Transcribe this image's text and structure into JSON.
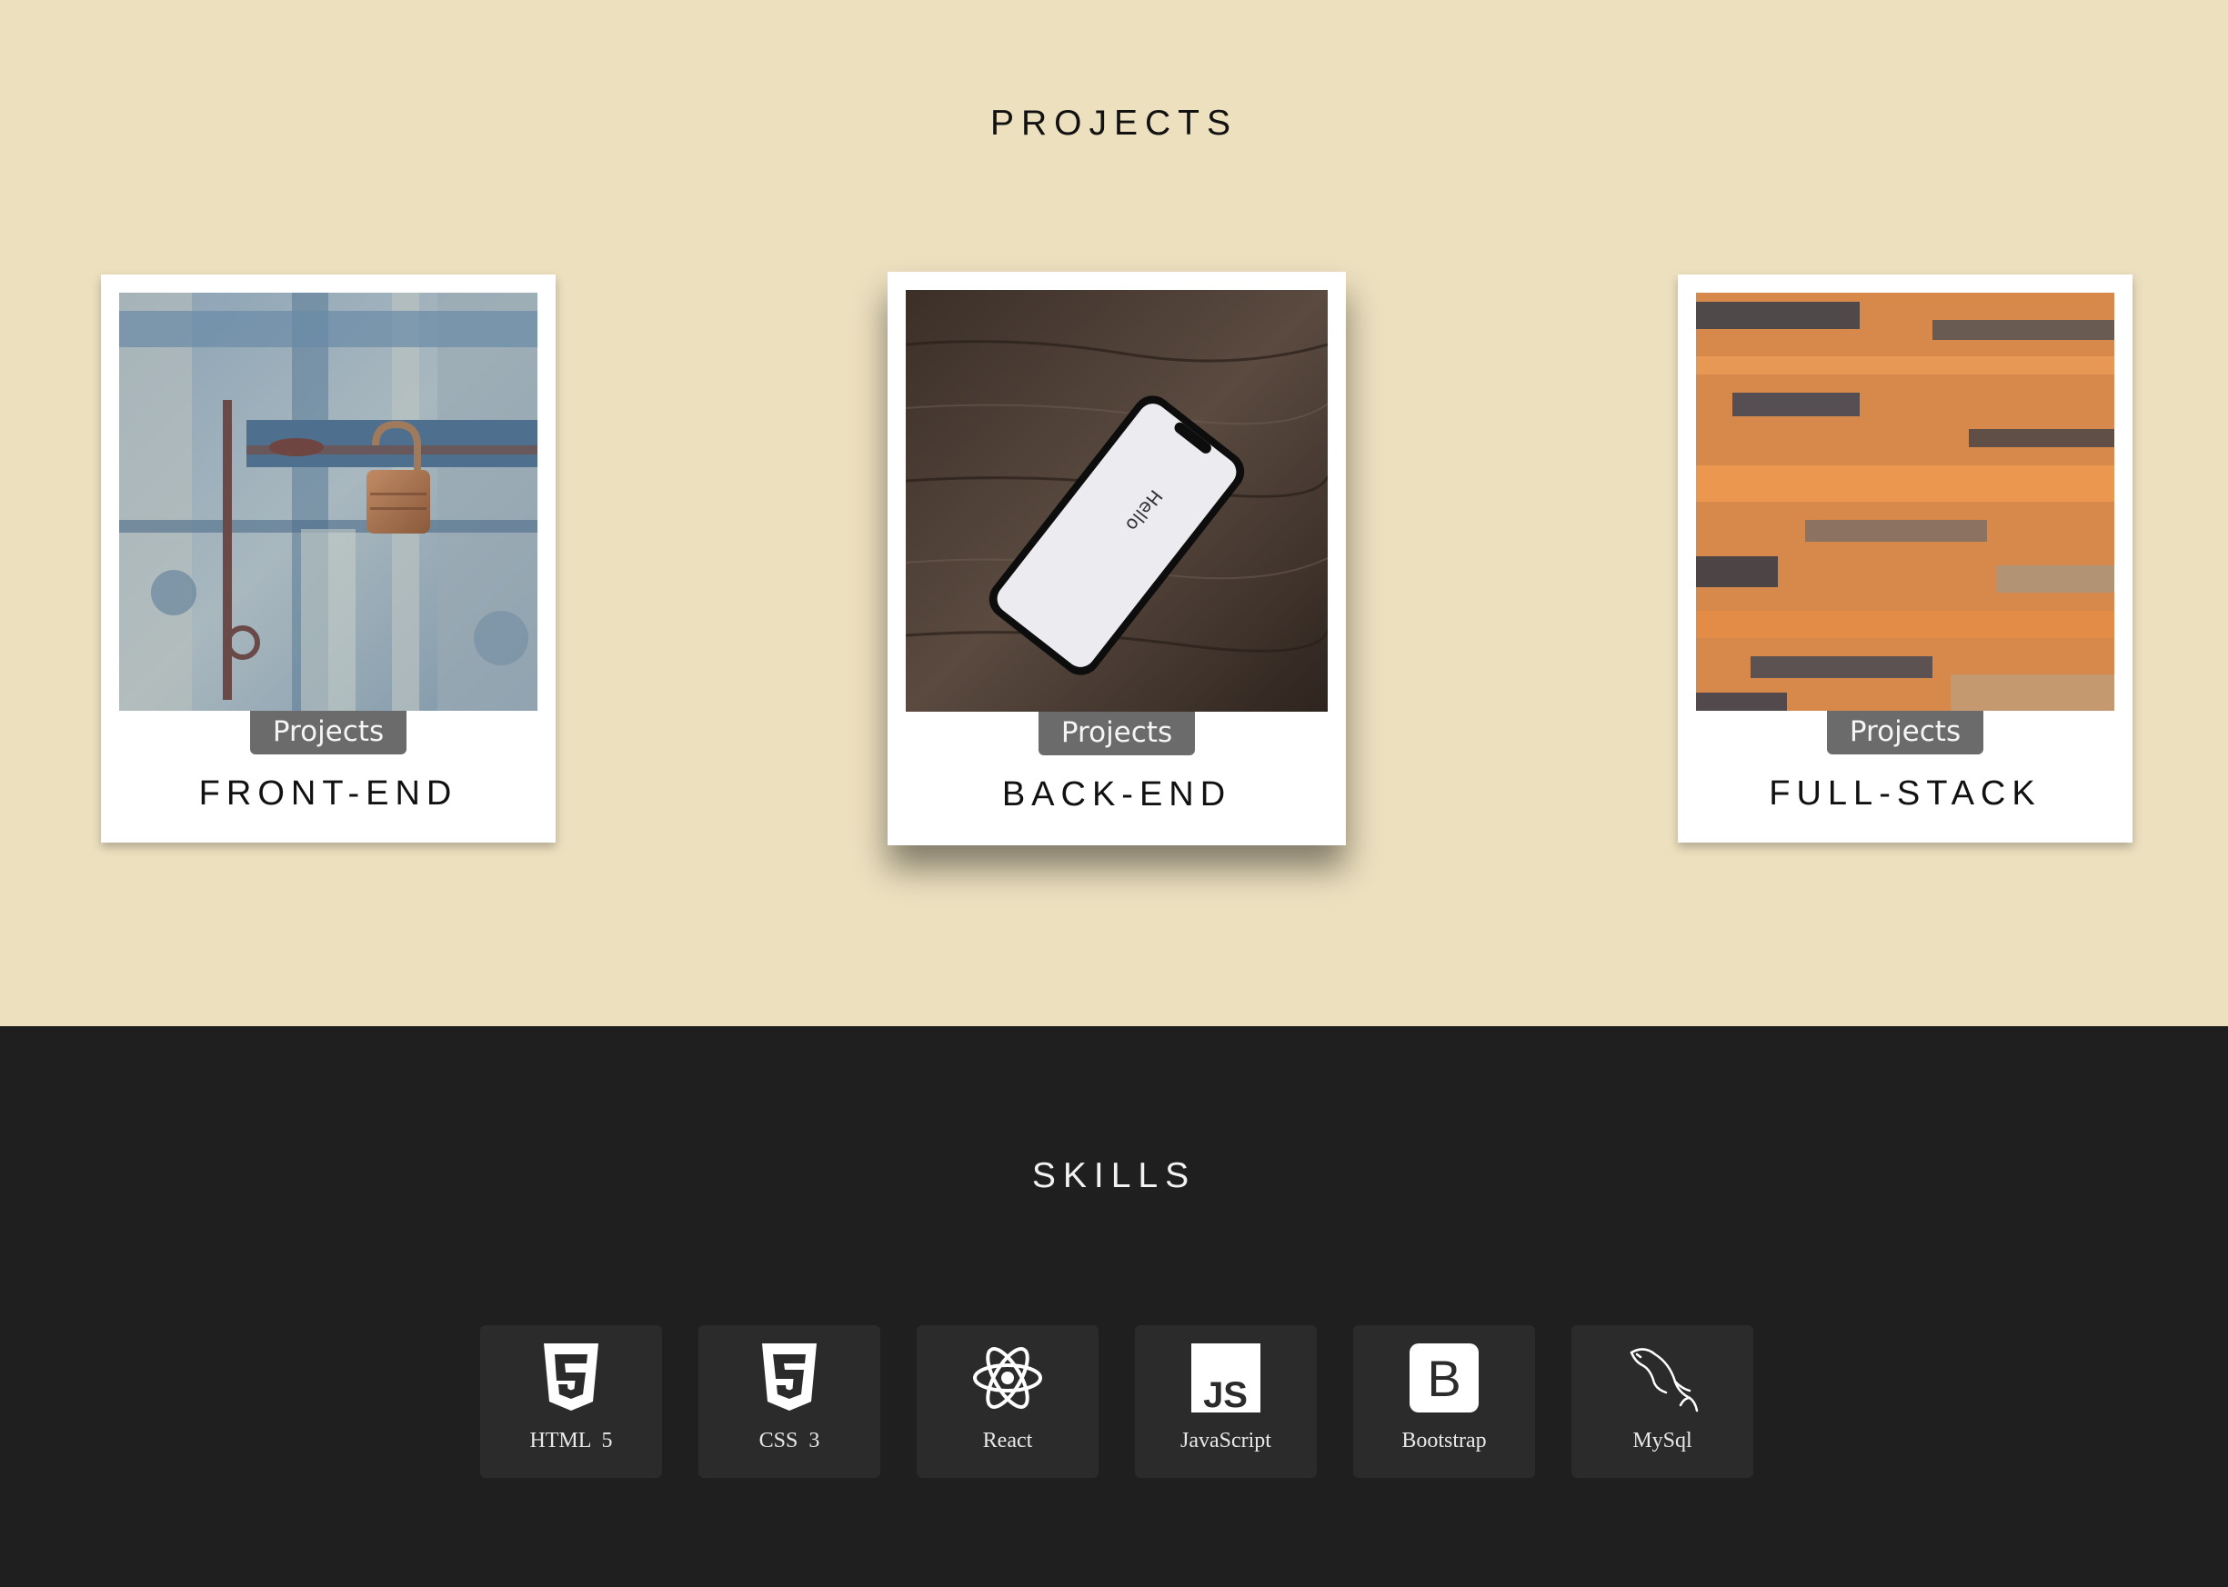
{
  "projects": {
    "title": "PROJECTS",
    "cards": [
      {
        "tag": "Projects",
        "title": "FRONT-END",
        "image": "padlock-on-blue-door"
      },
      {
        "tag": "Projects",
        "title": "BACK-END",
        "image": "phone-on-wood-table",
        "phone_text": "Hello"
      },
      {
        "tag": "Projects",
        "title": "FULL-STACK",
        "image": "orange-motion-blur"
      }
    ]
  },
  "skills": {
    "title": "SKILLS",
    "items": [
      {
        "label": "HTML  5",
        "icon": "html5-icon"
      },
      {
        "label": "CSS  3",
        "icon": "css3-icon"
      },
      {
        "label": "React",
        "icon": "react-icon"
      },
      {
        "label": "JavaScript",
        "icon": "javascript-icon"
      },
      {
        "label": "Bootstrap",
        "icon": "bootstrap-icon"
      },
      {
        "label": "MySql",
        "icon": "mysql-icon"
      }
    ]
  },
  "colors": {
    "projects_bg": "#ede0bf",
    "skills_bg": "#1f1f1f",
    "tag_bg": "#6b6b6b",
    "skill_tile_bg": "#2b2b2b"
  }
}
